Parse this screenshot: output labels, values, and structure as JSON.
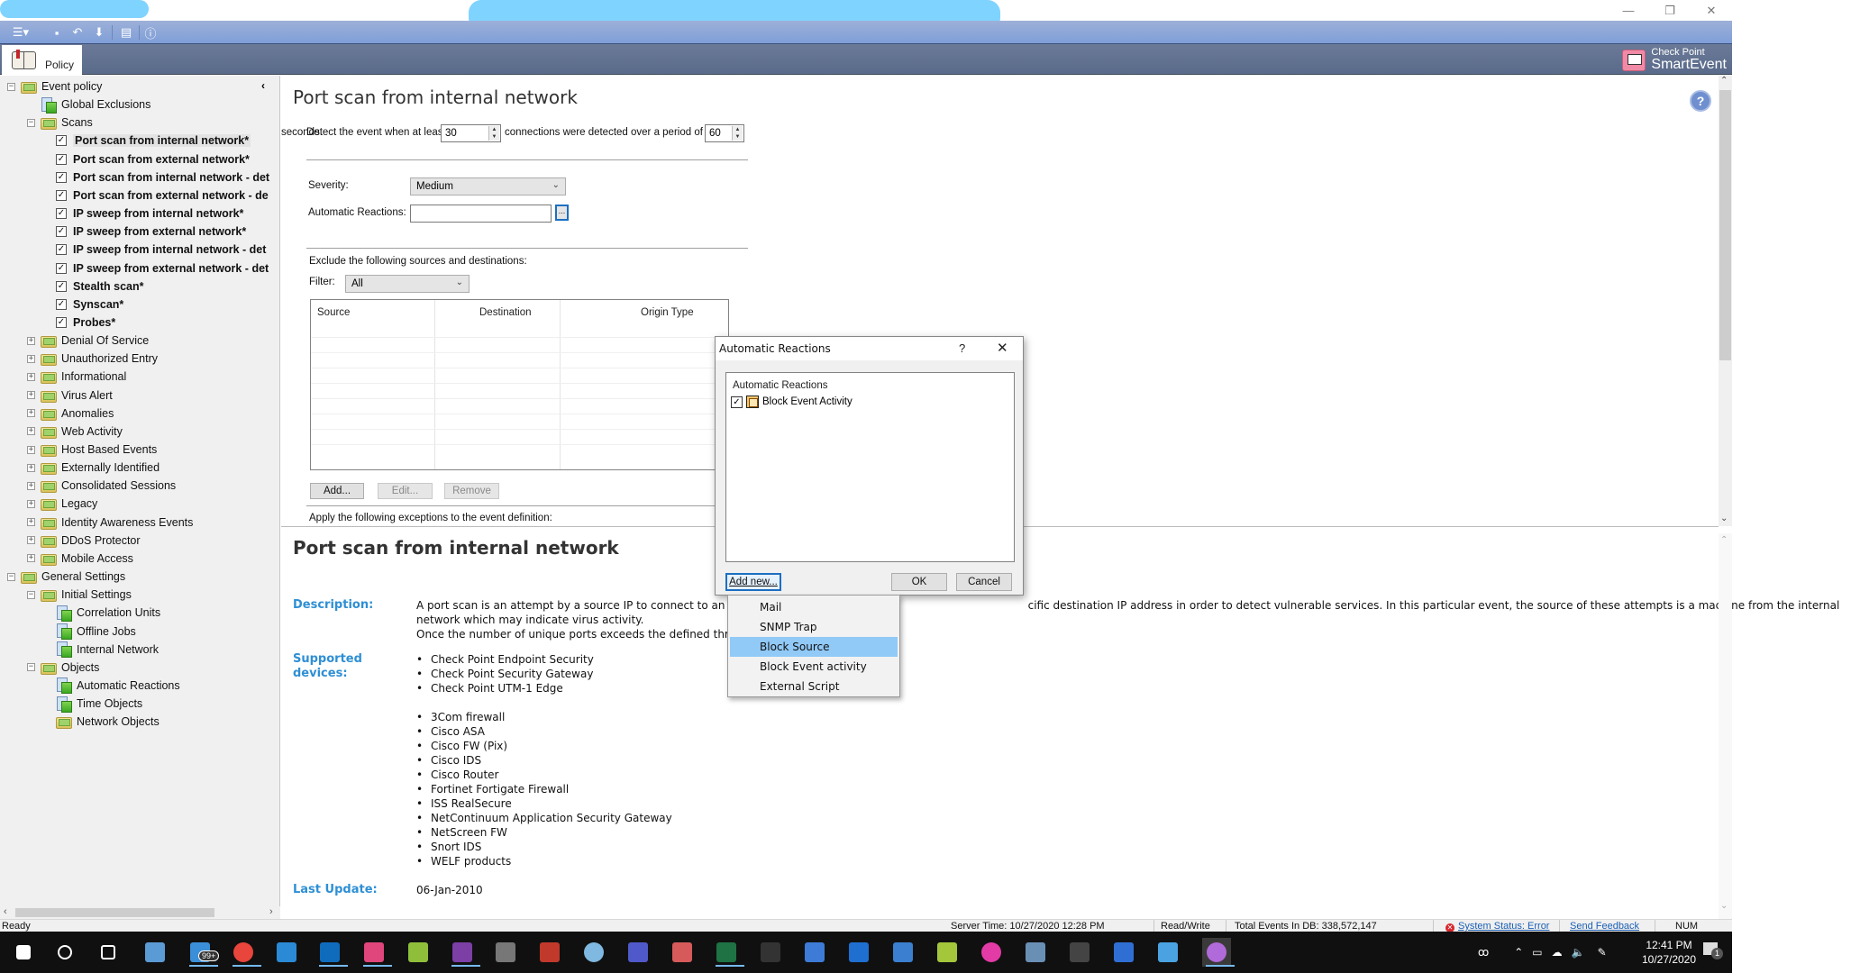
{
  "window": {
    "controls": {
      "minimize": "—",
      "restore": "❐",
      "close": "✕"
    },
    "brand_line1": "Check Point",
    "brand_line2": "SmartEvent"
  },
  "toolbar": {
    "icons": [
      "menu-icon",
      "save-icon",
      "undo-icon",
      "install-icon",
      "account-icon",
      "info-icon"
    ]
  },
  "tabs": [
    {
      "label": "Policy",
      "active": true
    }
  ],
  "sidebar": {
    "collapse_glyph": "‹",
    "tree": [
      {
        "label": "Event policy",
        "level": 0,
        "type": "folder",
        "expander": "−"
      },
      {
        "label": "Global Exclusions",
        "level": 1,
        "type": "doc"
      },
      {
        "label": "Scans",
        "level": 1,
        "type": "folder",
        "expander": "−"
      },
      {
        "label": "Port scan from internal network*",
        "level": 2,
        "type": "check",
        "checked": true,
        "selected": true
      },
      {
        "label": "Port scan from external network*",
        "level": 2,
        "type": "check",
        "checked": true
      },
      {
        "label": "Port scan from internal network - det",
        "level": 2,
        "type": "check",
        "checked": true
      },
      {
        "label": "Port scan from external network - de",
        "level": 2,
        "type": "check",
        "checked": true
      },
      {
        "label": "IP sweep from internal network*",
        "level": 2,
        "type": "check",
        "checked": true
      },
      {
        "label": "IP sweep from external network*",
        "level": 2,
        "type": "check",
        "checked": true
      },
      {
        "label": "IP sweep from internal network - det",
        "level": 2,
        "type": "check",
        "checked": true
      },
      {
        "label": "IP sweep from external network - det",
        "level": 2,
        "type": "check",
        "checked": true
      },
      {
        "label": "Stealth scan*",
        "level": 2,
        "type": "check",
        "checked": true
      },
      {
        "label": "Synscan*",
        "level": 2,
        "type": "check",
        "checked": true
      },
      {
        "label": "Probes*",
        "level": 2,
        "type": "check",
        "checked": true
      },
      {
        "label": "Denial Of Service",
        "level": 1,
        "type": "folder",
        "expander": "+"
      },
      {
        "label": "Unauthorized Entry",
        "level": 1,
        "type": "folder",
        "expander": "+"
      },
      {
        "label": "Informational",
        "level": 1,
        "type": "folder",
        "expander": "+"
      },
      {
        "label": "Virus Alert",
        "level": 1,
        "type": "folder",
        "expander": "+"
      },
      {
        "label": "Anomalies",
        "level": 1,
        "type": "folder",
        "expander": "+"
      },
      {
        "label": "Web Activity",
        "level": 1,
        "type": "folder",
        "expander": "+"
      },
      {
        "label": "Host Based Events",
        "level": 1,
        "type": "folder",
        "expander": "+"
      },
      {
        "label": "Externally Identified",
        "level": 1,
        "type": "folder",
        "expander": "+"
      },
      {
        "label": "Consolidated Sessions",
        "level": 1,
        "type": "folder",
        "expander": "+"
      },
      {
        "label": "Legacy",
        "level": 1,
        "type": "folder",
        "expander": "+"
      },
      {
        "label": "Identity Awareness Events",
        "level": 1,
        "type": "folder",
        "expander": "+"
      },
      {
        "label": "DDoS Protector",
        "level": 1,
        "type": "folder",
        "expander": "+"
      },
      {
        "label": "Mobile Access",
        "level": 1,
        "type": "folder",
        "expander": "+"
      },
      {
        "label": "General Settings",
        "level": 0,
        "type": "folder",
        "expander": "−"
      },
      {
        "label": "Initial Settings",
        "level": 1,
        "type": "folder",
        "expander": "−"
      },
      {
        "label": "Correlation Units",
        "level": 2,
        "type": "doc"
      },
      {
        "label": "Offline Jobs",
        "level": 2,
        "type": "doc"
      },
      {
        "label": "Internal Network",
        "level": 2,
        "type": "doc"
      },
      {
        "label": "Objects",
        "level": 1,
        "type": "folder",
        "expander": "−"
      },
      {
        "label": "Automatic Reactions",
        "level": 2,
        "type": "doc"
      },
      {
        "label": "Time Objects",
        "level": 2,
        "type": "doc"
      },
      {
        "label": "Network Objects",
        "level": 2,
        "type": "folder"
      }
    ]
  },
  "main": {
    "title": "Port scan from internal network",
    "detect": {
      "prefix": "Detect the event when at least",
      "connections_value": "30",
      "middle": "connections were detected over a period of",
      "period_value": "60",
      "suffix": "seconds."
    },
    "severity_label": "Severity:",
    "severity_value": "Medium",
    "auto_reactions_label": "Automatic Reactions:",
    "auto_reactions_value": "",
    "auto_reactions_browse": "...",
    "exclude_label": "Exclude the following sources and destinations:",
    "filter_label": "Filter:",
    "filter_value": "All",
    "table_columns": [
      "Source",
      "Destination",
      "Origin Type"
    ],
    "table_rows": [],
    "buttons": {
      "add": "Add...",
      "edit": "Edit...",
      "remove": "Remove"
    },
    "exceptions_label": "Apply the following exceptions to the event definition:"
  },
  "description": {
    "title": "Port scan from internal network",
    "description_label": "Description:",
    "description_line1": "A port scan is an attempt by a source IP to connect to an ex",
    "description_line1_tail": "cific destination IP address in order to detect vulnerable services. In this particular event, the source of these attempts is a machine from the internal",
    "description_line2": "network which may indicate virus activity.",
    "description_line3": "Once the number of unique ports exceeds the defined thres",
    "supported_label_1": "Supported",
    "supported_label_2": "devices:",
    "devices_checkpoint": [
      "Check Point Endpoint Security",
      "Check Point Security Gateway",
      "Check Point UTM-1 Edge"
    ],
    "devices_other": [
      "3Com firewall",
      "Cisco ASA",
      "Cisco FW (Pix)",
      "Cisco IDS",
      "Cisco Router",
      "Fortinet Fortigate Firewall",
      "ISS RealSecure",
      "NetContinuum Application Security Gateway",
      "NetScreen FW",
      "Snort IDS",
      "WELF products"
    ],
    "last_update_label": "Last Update:",
    "last_update_value": "06-Jan-2010"
  },
  "dialog": {
    "title": "Automatic Reactions",
    "help": "?",
    "close": "✕",
    "list_header": "Automatic Reactions",
    "items": [
      {
        "label": "Block Event Activity",
        "checked": true
      }
    ],
    "add_new": "Add new...",
    "ok": "OK",
    "cancel": "Cancel",
    "menu": [
      {
        "label": "Mail",
        "hover": false
      },
      {
        "label": "SNMP Trap",
        "hover": false
      },
      {
        "label": "Block Source",
        "hover": true
      },
      {
        "label": "Block Event activity",
        "hover": false
      },
      {
        "label": "External Script",
        "hover": false
      }
    ]
  },
  "statusbar": {
    "ready": "Ready",
    "server_time": "Server Time: 10/27/2020 12:28 PM",
    "mode": "Read/Write",
    "total_events": "Total Events In DB: 338,572,147",
    "system_status": "System Status: Error",
    "send_feedback": "Send Feedback",
    "num": "NUM"
  },
  "taskbar": {
    "mail_badge": "99+",
    "time": "12:41 PM",
    "date": "10/27/2020",
    "notification_count": "1",
    "apps": [
      {
        "name": "start",
        "color": "#ffffff"
      },
      {
        "name": "search",
        "color": "#ffffff"
      },
      {
        "name": "task-view",
        "color": "#ffffff"
      },
      {
        "name": "remote-desktop",
        "color": "#5b9bd5"
      },
      {
        "name": "mail",
        "color": "#3b8fd8"
      },
      {
        "name": "chrome",
        "color": "#e8453c"
      },
      {
        "name": "internet-explorer",
        "color": "#2a8ad6"
      },
      {
        "name": "outlook",
        "color": "#0f6cbd"
      },
      {
        "name": "app-crown",
        "color": "#e0457b"
      },
      {
        "name": "notepad-plus",
        "color": "#8fbf3a"
      },
      {
        "name": "onenote",
        "color": "#7b3fa6"
      },
      {
        "name": "vpn-lock",
        "color": "#777777"
      },
      {
        "name": "app-red",
        "color": "#c0392b"
      },
      {
        "name": "app-eye",
        "color": "#7fb8e0"
      },
      {
        "name": "teams",
        "color": "#5059c9"
      },
      {
        "name": "snipping",
        "color": "#d65a5a"
      },
      {
        "name": "excel",
        "color": "#1f7244"
      },
      {
        "name": "cmd",
        "color": "#333333"
      },
      {
        "name": "network-tool",
        "color": "#3e7bd6"
      },
      {
        "name": "wireshark",
        "color": "#1f6fd1"
      },
      {
        "name": "network-monitor",
        "color": "#3a7fd0"
      },
      {
        "name": "script-tool",
        "color": "#a4c63b"
      },
      {
        "name": "app-pink",
        "color": "#e23ba5"
      },
      {
        "name": "calculator",
        "color": "#6a8fb5"
      },
      {
        "name": "terminal",
        "color": "#444444"
      },
      {
        "name": "remote-app",
        "color": "#2f6fd4"
      },
      {
        "name": "app-funnel",
        "color": "#4aa3e0"
      },
      {
        "name": "smartevent",
        "color": "#b06ad9"
      }
    ]
  }
}
